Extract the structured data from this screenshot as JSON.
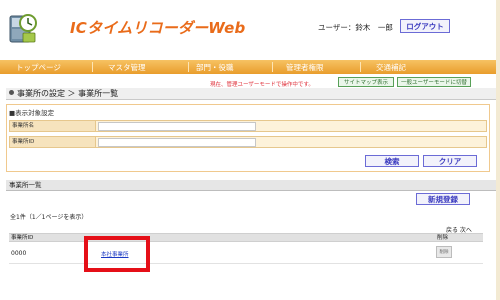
{
  "header": {
    "app_title": "ICタイムリコーダーWeb",
    "user_label": "ユーザー：鈴木　一郎",
    "logout_label": "ログアウト"
  },
  "nav": {
    "items": [
      "トップページ",
      "マスタ管理",
      "部門・役職",
      "管理者権限",
      "交通補記"
    ]
  },
  "notice": {
    "warning": "現在、管理ユーザーモードで操作中です。",
    "sitemap_label": "サイトマップ表示",
    "switch_label": "一般ユーザーモードに切替"
  },
  "breadcrumb": "事業所の設定 ＞ 事業所一覧",
  "filter": {
    "heading": "■表示対象設定",
    "office_name_label": "事業所名",
    "office_id_label": "事業所ID",
    "office_name_value": "",
    "office_id_value": "",
    "search_label": "検索",
    "clear_label": "クリア"
  },
  "list": {
    "section_title": "事業所一覧",
    "new_label": "新規登録",
    "count_text": "全1件（1／1ページを表示）",
    "pager_text": "戻る 次へ",
    "headers": {
      "id": "事業所ID",
      "delete": "削除"
    },
    "rows": [
      {
        "id": "0000",
        "name": "本社事業所",
        "delete_label": "削除"
      }
    ]
  },
  "colors": {
    "accent_orange": "#e96b1a",
    "nav_orange": "#e99d2c",
    "highlight_red": "#e50f18",
    "link_blue": "#1a38c4"
  }
}
